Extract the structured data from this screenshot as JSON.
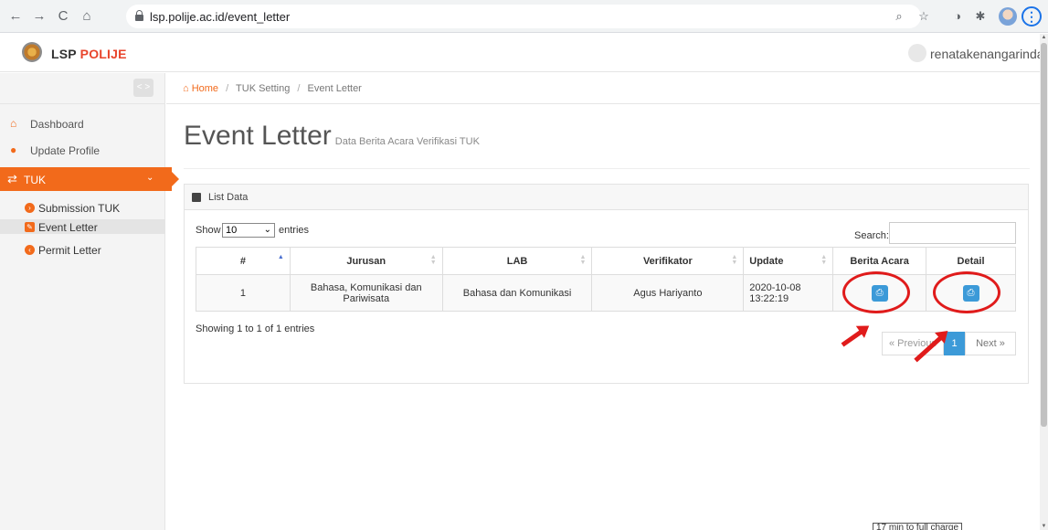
{
  "browser": {
    "url": "lsp.polije.ac.id/event_letter",
    "back_icon": "←",
    "forward_icon": "→",
    "reload_icon": "C",
    "home_icon": "⌂",
    "zoom_icon": "⌕",
    "star_icon": "☆",
    "ext1_icon": "◑",
    "ext2_icon": "✱",
    "menu_icon": "⋮"
  },
  "header": {
    "brand_lsp": "LSP",
    "brand_polije": "POLIJE",
    "username": "renatakenangarinda",
    "caret": "⌄"
  },
  "sidebar": {
    "toggle": "< >",
    "dashboard": "Dashboard",
    "update_profile": "Update Profile",
    "tuk": "TUK",
    "tuk_icon": "⇄",
    "tuk_chevron": "⌄",
    "submission_tuk": "Submission TUK",
    "event_letter": "Event Letter",
    "permit_letter": "Permit Letter"
  },
  "breadcrumb": {
    "home": "Home",
    "sep": "/",
    "tuk_setting": "TUK Setting",
    "current": "Event Letter"
  },
  "page": {
    "title": "Event Letter",
    "subtitle": "Data Berita Acara Verifikasi TUK"
  },
  "panel": {
    "title": "List Data",
    "show": "Show",
    "entries_value": "10",
    "entries": "entries",
    "search": "Search:",
    "info": "Showing 1 to 1 of 1 entries"
  },
  "table": {
    "headers": [
      "#",
      "Jurusan",
      "LAB",
      "Verifikator",
      "Update",
      "Berita Acara",
      "Detail"
    ],
    "rows": [
      {
        "no": "1",
        "jurusan": "Bahasa, Komunikasi dan Pariwisata",
        "lab": "Bahasa dan Komunikasi",
        "verifikator": "Agus Hariyanto",
        "update": "2020-10-08 13:22:19"
      }
    ]
  },
  "pagination": {
    "prev": "« Previous",
    "current": "1",
    "next": "Next »"
  },
  "tooltip_fragment": "17 min to full charge",
  "colors": {
    "accent": "#f26a1b",
    "button_blue": "#3c9ad8",
    "annotation_red": "#e01b1b"
  }
}
